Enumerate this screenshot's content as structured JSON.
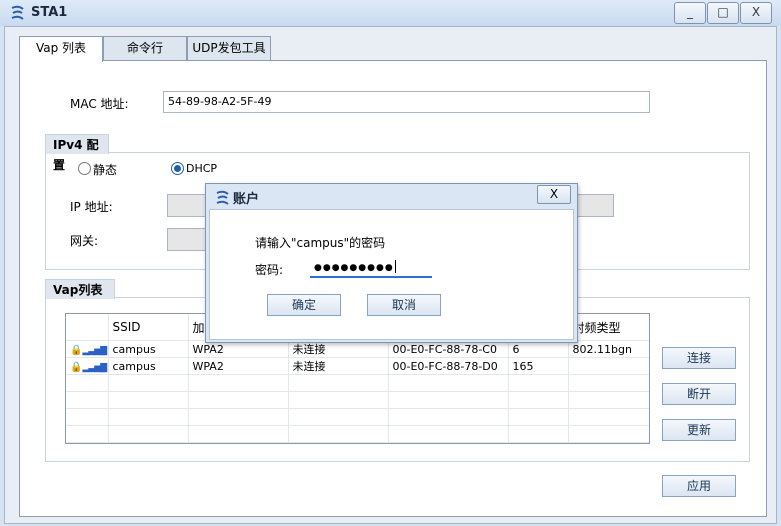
{
  "window": {
    "title": "STA1",
    "minimize": "_",
    "maximize": "□",
    "close": "X"
  },
  "tabs": [
    {
      "label": "Vap 列表"
    },
    {
      "label": "命令行"
    },
    {
      "label": "UDP发包工具"
    }
  ],
  "mac": {
    "label": "MAC 地址:",
    "value": "54-89-98-A2-5F-49"
  },
  "ipv4": {
    "legend": "IPv4 配置",
    "static_label": "静态",
    "dhcp_label": "DHCP",
    "selected": "DHCP",
    "ip_label": "IP 地址:",
    "gateway_label": "网关:"
  },
  "vap": {
    "legend": "Vap列表",
    "columns": [
      "SSID",
      "加",
      "",
      "",
      "",
      "射频类型"
    ],
    "rows": [
      {
        "ssid": "campus",
        "enc": "WPA2",
        "status": "未连接",
        "bssid": "00-E0-FC-88-78-C0",
        "channel": "6",
        "radio": "802.11bgn"
      },
      {
        "ssid": "campus",
        "enc": "WPA2",
        "status": "未连接",
        "bssid": "00-E0-FC-88-78-D0",
        "channel": "165",
        "radio": ""
      }
    ],
    "connect": "连接",
    "disconnect": "断开",
    "refresh": "更新"
  },
  "apply": "应用",
  "dialog": {
    "title": "账户",
    "close": "X",
    "prompt": "请输入\"campus\"的密码",
    "password_label": "密码:",
    "password_value": "●●●●●●●●●",
    "ok": "确定",
    "cancel": "取消"
  }
}
